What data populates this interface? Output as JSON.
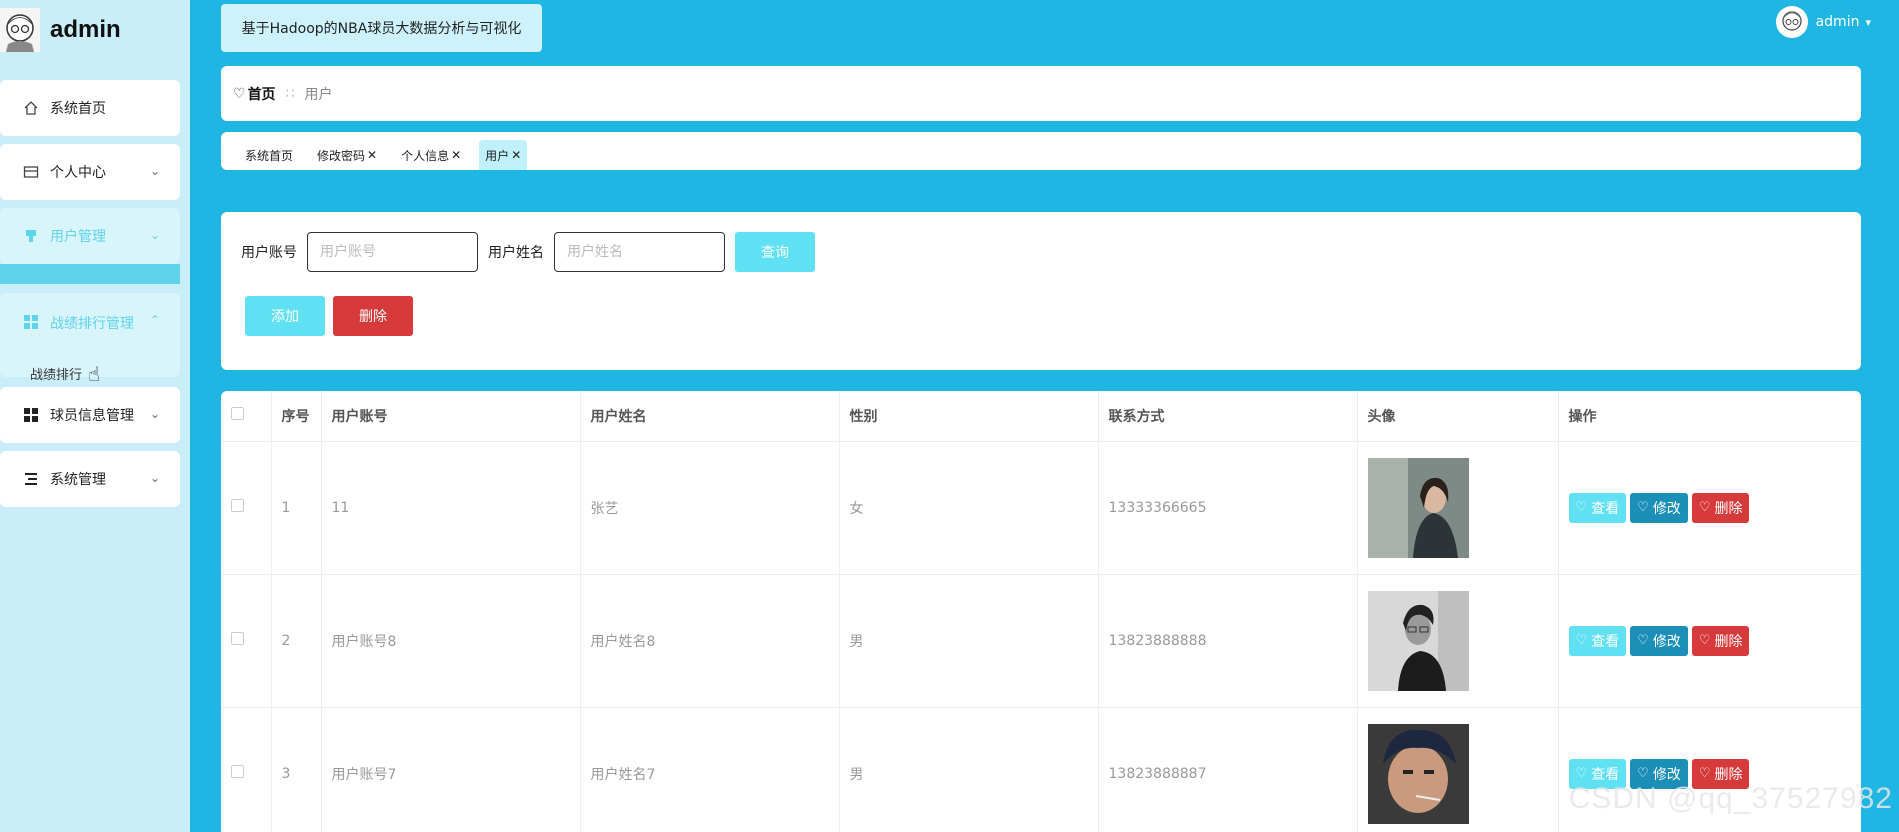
{
  "app": {
    "name": "admin"
  },
  "sidebar": {
    "items": [
      {
        "label": "系统首页",
        "icon": "home-icon"
      },
      {
        "label": "个人中心",
        "icon": "card-icon"
      },
      {
        "label": "用户管理",
        "icon": "user-manage-icon"
      },
      {
        "label": "战绩排行管理",
        "icon": "grid-icon"
      },
      {
        "label": "球员信息管理",
        "icon": "grid-icon"
      },
      {
        "label": "系统管理",
        "icon": "list-icon"
      }
    ],
    "sub_item": "战绩排行"
  },
  "header": {
    "system_title": "基于Hadoop的NBA球员大数据分析与可视化",
    "user": "admin"
  },
  "breadcrumb": {
    "home": "首页",
    "current": "用户"
  },
  "tabs": [
    {
      "label": "系统首页",
      "closable": false
    },
    {
      "label": "修改密码",
      "closable": true
    },
    {
      "label": "个人信息",
      "closable": true
    },
    {
      "label": "用户",
      "closable": true
    }
  ],
  "search": {
    "account_label": "用户账号",
    "account_placeholder": "用户账号",
    "name_label": "用户姓名",
    "name_placeholder": "用户姓名",
    "query_label": "查询",
    "add_label": "添加",
    "delete_label": "删除"
  },
  "table": {
    "columns": [
      "序号",
      "用户账号",
      "用户姓名",
      "性别",
      "联系方式",
      "头像",
      "操作"
    ],
    "rows": [
      {
        "index": "1",
        "account": "11",
        "name": "张艺",
        "gender": "女",
        "phone": "13333366665"
      },
      {
        "index": "2",
        "account": "用户账号8",
        "name": "用户姓名8",
        "gender": "男",
        "phone": "13823888888"
      },
      {
        "index": "3",
        "account": "用户账号7",
        "name": "用户姓名7",
        "gender": "男",
        "phone": "13823888887"
      }
    ],
    "actions": {
      "view": "查看",
      "edit": "修改",
      "delete": "删除"
    }
  },
  "watermark": "CSDN @qq_37527982",
  "colors": {
    "background": "#1fb6e4",
    "sidebar": "#c9eef9",
    "accent_cyan": "#5fd3ea",
    "edit_blue": "#1b8fb8",
    "danger_red": "#d63a3a"
  }
}
